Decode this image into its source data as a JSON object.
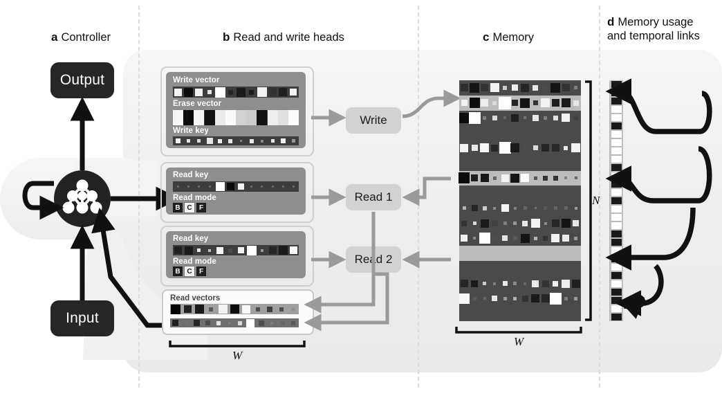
{
  "panels": [
    {
      "letter": "a",
      "title": "Controller"
    },
    {
      "letter": "b",
      "title": "Read and write heads"
    },
    {
      "letter": "c",
      "title": "Memory"
    },
    {
      "letter": "d",
      "title": "Memory usage",
      "title2": "and temporal links"
    }
  ],
  "controller": {
    "output_label": "Output",
    "input_label": "Input",
    "node_icon": "neural-network-icon"
  },
  "heads": {
    "write": {
      "rows": [
        {
          "label": "Write vector",
          "cells": [
            [
              0.95,
              11
            ],
            [
              0.05,
              13
            ],
            [
              0.95,
              11
            ],
            [
              0.9,
              6
            ],
            [
              1.0,
              18
            ],
            [
              0.15,
              7
            ],
            [
              0.1,
              13
            ],
            [
              0.1,
              7
            ],
            [
              0.95,
              14
            ],
            [
              0.2,
              12
            ],
            [
              0.12,
              12
            ],
            [
              0.95,
              10
            ]
          ]
        },
        {
          "label": "Erase vector",
          "cells": [
            [
              0.97,
              15
            ],
            [
              0.05,
              15
            ],
            [
              0.96,
              15
            ],
            [
              0.07,
              15
            ],
            [
              0.92,
              15
            ],
            [
              0.98,
              15
            ],
            [
              0.82,
              15
            ],
            [
              0.8,
              15
            ],
            [
              0.07,
              15
            ],
            [
              0.93,
              15
            ],
            [
              0.88,
              15
            ],
            [
              0.99,
              15
            ]
          ]
        },
        {
          "label": "Write key",
          "cells": [
            [
              0.95,
              7
            ],
            [
              0.9,
              5
            ],
            [
              0.85,
              5
            ],
            [
              0.9,
              9
            ],
            [
              0.95,
              6
            ],
            [
              0.9,
              6
            ],
            [
              0.5,
              3
            ],
            [
              0.92,
              6
            ],
            [
              0.55,
              4
            ],
            [
              0.9,
              5
            ],
            [
              0.95,
              7
            ],
            [
              0.6,
              5
            ]
          ]
        }
      ]
    },
    "read1": {
      "key_label": "Read key",
      "key_cells": [
        [
          0.4,
          3
        ],
        [
          0.4,
          3
        ],
        [
          0.4,
          3
        ],
        [
          0.4,
          3
        ],
        [
          1.0,
          13
        ],
        [
          0.05,
          11
        ],
        [
          0.95,
          9
        ],
        [
          0.4,
          3
        ],
        [
          0.4,
          3
        ],
        [
          0.4,
          3
        ],
        [
          0.4,
          3
        ],
        [
          0.4,
          3
        ]
      ],
      "mode_label": "Read mode",
      "modes": [
        {
          "key": "B",
          "selected": false
        },
        {
          "key": "C",
          "selected": true
        },
        {
          "key": "F",
          "selected": false
        }
      ]
    },
    "read2": {
      "key_label": "Read key",
      "key_cells": [
        [
          0.12,
          11
        ],
        [
          0.1,
          12
        ],
        [
          0.9,
          5
        ],
        [
          0.75,
          4
        ],
        [
          0.97,
          10
        ],
        [
          0.3,
          6
        ],
        [
          0.95,
          9
        ],
        [
          1.0,
          15
        ],
        [
          0.6,
          4
        ],
        [
          0.15,
          11
        ],
        [
          0.1,
          13
        ],
        [
          0.98,
          11
        ]
      ]
    },
    "read2_mode": {
      "mode_label": "Read mode",
      "modes": [
        {
          "key": "B",
          "selected": false
        },
        {
          "key": "C",
          "selected": true
        },
        {
          "key": "F",
          "selected": false
        }
      ]
    },
    "read_vectors": {
      "label": "Read vectors",
      "rows": [
        [
          [
            0.02,
            17
          ],
          [
            0.13,
            11
          ],
          [
            0.1,
            13
          ],
          [
            0.35,
            6
          ],
          [
            0.95,
            13
          ],
          [
            0.05,
            13
          ],
          [
            0.97,
            12
          ],
          [
            0.3,
            6
          ],
          [
            0.25,
            8
          ],
          [
            0.3,
            6
          ],
          [
            0.55,
            4
          ]
        ],
        [
          [
            0.12,
            9
          ],
          [
            0.45,
            5
          ],
          [
            0.15,
            9
          ],
          [
            0.3,
            7
          ],
          [
            0.9,
            6
          ],
          [
            0.5,
            3
          ],
          [
            0.85,
            6
          ],
          [
            1.0,
            13
          ],
          [
            0.3,
            8
          ],
          [
            0.5,
            4
          ],
          [
            0.4,
            6
          ],
          [
            0.35,
            6
          ]
        ]
      ],
      "width_label": "W"
    },
    "nodes": {
      "write": "Write",
      "read1": "Read 1",
      "read2": "Read 2"
    }
  },
  "memory": {
    "n_label": "N",
    "w_label": "W",
    "cols": 12,
    "rows": 16,
    "highlighted_rows": [
      1,
      6,
      11
    ],
    "grid": [
      [
        [
          0.18,
          11
        ],
        [
          0.08,
          14
        ],
        [
          0.2,
          11
        ],
        [
          0.95,
          13
        ],
        [
          0.8,
          6
        ],
        [
          0.93,
          9
        ],
        [
          0.15,
          12
        ],
        [
          0.9,
          8
        ],
        [
          0.3,
          5
        ],
        [
          0.08,
          14
        ],
        [
          0.2,
          11
        ],
        [
          0.5,
          5
        ]
      ],
      [
        [
          0.95,
          9
        ],
        [
          0.05,
          15
        ],
        [
          0.93,
          11
        ],
        [
          0.85,
          6
        ],
        [
          1.0,
          18
        ],
        [
          0.15,
          9
        ],
        [
          0.08,
          14
        ],
        [
          0.2,
          7
        ],
        [
          0.95,
          13
        ],
        [
          0.12,
          11
        ],
        [
          0.1,
          13
        ],
        [
          0.9,
          8
        ]
      ],
      [
        [
          0.05,
          15
        ],
        [
          1.0,
          17
        ],
        [
          0.5,
          5
        ],
        [
          0.85,
          7
        ],
        [
          0.4,
          4
        ],
        [
          0.12,
          11
        ],
        [
          0.45,
          4
        ],
        [
          0.9,
          9
        ],
        [
          0.5,
          5
        ],
        [
          0.88,
          7
        ],
        [
          0.95,
          12
        ],
        [
          0.25,
          7
        ]
      ],
      [
        [
          0,
          0
        ],
        [
          0,
          0
        ],
        [
          0,
          0
        ],
        [
          0,
          0
        ],
        [
          0,
          0
        ],
        [
          0,
          0
        ],
        [
          0,
          0
        ],
        [
          0,
          0
        ],
        [
          0,
          0
        ],
        [
          0,
          0
        ],
        [
          0,
          0
        ],
        [
          0,
          0
        ]
      ],
      [
        [
          0.95,
          12
        ],
        [
          0.9,
          9
        ],
        [
          0.96,
          13
        ],
        [
          0.15,
          10
        ],
        [
          1.0,
          17
        ],
        [
          0.1,
          13
        ],
        [
          0.3,
          6
        ],
        [
          0.85,
          7
        ],
        [
          0.14,
          11
        ],
        [
          0.16,
          11
        ],
        [
          0.9,
          6
        ],
        [
          0.95,
          13
        ]
      ],
      [
        [
          0,
          0
        ],
        [
          0,
          0
        ],
        [
          0,
          0
        ],
        [
          0,
          0
        ],
        [
          0,
          0
        ],
        [
          0,
          0
        ],
        [
          0,
          0
        ],
        [
          0,
          0
        ],
        [
          0,
          0
        ],
        [
          0,
          0
        ],
        [
          0,
          0
        ],
        [
          0,
          0
        ]
      ],
      [
        [
          0.05,
          16
        ],
        [
          0.12,
          10
        ],
        [
          0.1,
          12
        ],
        [
          0.4,
          5
        ],
        [
          0.95,
          11
        ],
        [
          0.08,
          13
        ],
        [
          0.98,
          12
        ],
        [
          0.35,
          5
        ],
        [
          0.2,
          7
        ],
        [
          0.2,
          7
        ],
        [
          0.5,
          4
        ],
        [
          0.4,
          4
        ]
      ],
      [
        [
          0,
          0
        ],
        [
          0,
          0
        ],
        [
          0,
          0
        ],
        [
          0,
          0
        ],
        [
          0,
          0
        ],
        [
          0,
          0
        ],
        [
          0,
          0
        ],
        [
          0,
          0
        ],
        [
          0,
          0
        ],
        [
          0,
          0
        ],
        [
          0,
          0
        ],
        [
          0,
          0
        ]
      ],
      [
        [
          0.7,
          5
        ],
        [
          0.15,
          9
        ],
        [
          0.8,
          6
        ],
        [
          0.55,
          4
        ],
        [
          0.95,
          11
        ],
        [
          0.5,
          4
        ],
        [
          0.4,
          5
        ],
        [
          0.45,
          3
        ],
        [
          0.35,
          5
        ],
        [
          0.4,
          5
        ],
        [
          0.4,
          5
        ],
        [
          0.6,
          4
        ]
      ],
      [
        [
          0.2,
          8
        ],
        [
          0.85,
          5
        ],
        [
          0.1,
          12
        ],
        [
          0.25,
          9
        ],
        [
          0.5,
          5
        ],
        [
          0.6,
          5
        ],
        [
          0.9,
          8
        ],
        [
          0.95,
          13
        ],
        [
          0.55,
          4
        ],
        [
          0.15,
          11
        ],
        [
          0.08,
          13
        ],
        [
          0.9,
          9
        ]
      ],
      [
        [
          0.95,
          10
        ],
        [
          0.55,
          4
        ],
        [
          1.0,
          16
        ],
        [
          0.3,
          6
        ],
        [
          0.9,
          8
        ],
        [
          0.35,
          6
        ],
        [
          0.08,
          13
        ],
        [
          0.7,
          5
        ],
        [
          0.2,
          7
        ],
        [
          0.95,
          12
        ],
        [
          0.92,
          10
        ],
        [
          0.6,
          5
        ]
      ],
      [
        [
          0,
          0
        ],
        [
          0,
          0
        ],
        [
          0,
          0
        ],
        [
          0,
          0
        ],
        [
          0,
          0
        ],
        [
          0,
          0
        ],
        [
          0,
          0
        ],
        [
          0,
          0
        ],
        [
          0,
          0
        ],
        [
          0,
          0
        ],
        [
          0,
          0
        ],
        [
          0,
          0
        ]
      ],
      [
        [
          0,
          0
        ],
        [
          0,
          0
        ],
        [
          0,
          0
        ],
        [
          0,
          0
        ],
        [
          0,
          0
        ],
        [
          0,
          0
        ],
        [
          0,
          0
        ],
        [
          0,
          0
        ],
        [
          0,
          0
        ],
        [
          0,
          0
        ],
        [
          0,
          0
        ],
        [
          0,
          0
        ]
      ],
      [
        [
          0.15,
          11
        ],
        [
          0.1,
          10
        ],
        [
          0.8,
          5
        ],
        [
          0.5,
          4
        ],
        [
          0.9,
          7
        ],
        [
          0.55,
          5
        ],
        [
          0.4,
          4
        ],
        [
          0.92,
          10
        ],
        [
          0.2,
          10
        ],
        [
          0.95,
          8
        ],
        [
          0.93,
          12
        ],
        [
          0.12,
          12
        ]
      ],
      [
        [
          0.97,
          15
        ],
        [
          0.35,
          5
        ],
        [
          0.4,
          4
        ],
        [
          0.9,
          8
        ],
        [
          0.6,
          5
        ],
        [
          0.7,
          5
        ],
        [
          0.2,
          9
        ],
        [
          0.1,
          12
        ],
        [
          0.15,
          12
        ],
        [
          1.0,
          17
        ],
        [
          0.5,
          5
        ],
        [
          0.6,
          5
        ]
      ],
      [
        [
          0,
          0
        ],
        [
          0,
          0
        ],
        [
          0,
          0
        ],
        [
          0,
          0
        ],
        [
          0,
          0
        ],
        [
          0,
          0
        ],
        [
          0,
          0
        ],
        [
          0,
          0
        ],
        [
          0,
          0
        ],
        [
          0,
          0
        ],
        [
          0,
          0
        ],
        [
          0,
          0
        ]
      ]
    ]
  },
  "usage": {
    "cells": [
      1,
      1,
      1,
      0,
      0,
      1,
      0,
      0,
      0,
      0,
      1,
      0,
      1,
      0,
      1,
      0,
      0,
      0,
      1,
      1,
      0,
      1,
      0,
      1,
      0,
      1,
      1,
      0,
      1
    ],
    "link_arrows": 3
  },
  "colors": {
    "dark_box": "#262626",
    "card_grey": "#8e8e8e",
    "node_grey": "#d2d2d2",
    "memory_bg": "#4a4a4a",
    "highlight_row": "#bcbcbc",
    "arrow_grey": "#9a9a9a",
    "arrow_black": "#111111",
    "blob": "#f2f2f2",
    "divider": "#d8dede"
  }
}
